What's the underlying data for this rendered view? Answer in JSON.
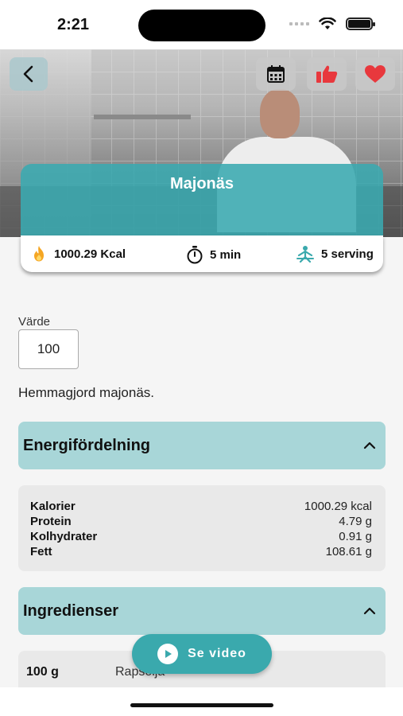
{
  "status": {
    "time": "2:21"
  },
  "recipe": {
    "title": "Majonäs",
    "calories": "1000.29 Kcal",
    "time": "5 min",
    "servings": "5 serving"
  },
  "value": {
    "label": "Värde",
    "input_value": "100"
  },
  "description": "Hemmagjord majonäs.",
  "energy": {
    "title": "Energifördelning",
    "rows": [
      {
        "name": "Kalorier",
        "value": "1000.29 kcal"
      },
      {
        "name": "Protein",
        "value": "4.79 g"
      },
      {
        "name": "Kolhydrater",
        "value": "0.91 g"
      },
      {
        "name": "Fett",
        "value": "108.61 g"
      }
    ]
  },
  "ingredients": {
    "title": "Ingredienser",
    "items": [
      {
        "amount": "100 g",
        "name": "Rapsolja"
      }
    ]
  },
  "video_button": {
    "label": "Se video"
  },
  "colors": {
    "accent": "#3aa9ad",
    "section_bg": "#a8d6d8",
    "like": "#e8383d"
  }
}
